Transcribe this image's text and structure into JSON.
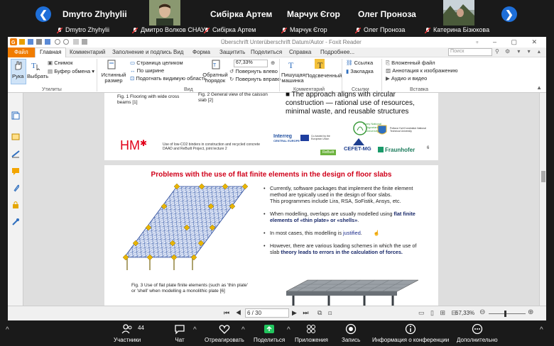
{
  "participants_top": [
    {
      "name": "Dmytro Zhyhylii",
      "label": "Dmytro Zhyhylii"
    },
    {
      "name": "",
      "label": "Дмитро Волков СНАУ"
    },
    {
      "name": "Сибірка Артем",
      "label": "Сибірка Артем"
    },
    {
      "name": "Марчук Єгор",
      "label": "Марчук Єгор"
    },
    {
      "name": "Олег Проноза",
      "label": "Олег Проноза"
    },
    {
      "name": "",
      "label": "Катерина Бізюкова"
    }
  ],
  "window": {
    "title": "Überschrift Unterüberschrift   Datum/Autor - Foxit Reader",
    "menu": [
      "Файл",
      "Главная",
      "Комментарий",
      "Заполнение и подпись",
      "Вид",
      "Форма",
      "Защитить",
      "Поделиться",
      "Справка",
      "Подробнее..."
    ],
    "search_placeholder": "Поиск"
  },
  "ribbon": {
    "hand": "Рука",
    "select": "Выбрать",
    "snapshot": "Снимок",
    "clipboard": "Буфер обмена",
    "group_tools": "Утилиты",
    "actual_size": "Истинный размер",
    "fit_page": "Страница целиком",
    "fit_width": "По ширине",
    "fit_visible": "Подогнать видимую область",
    "reflow": "Обратный порядок",
    "zoom": "67,33%",
    "rotate_left": "Повернуть влево",
    "rotate_right": "Повернуть вправо",
    "group_view": "Вид",
    "typewriter": "Пишущая машинка",
    "highlight": "Подсвеченный",
    "group_comment": "Комментарий",
    "link": "Ссылка",
    "bookmark": "Закладка",
    "group_links": "Ссылки",
    "attach_file": "Вложенный файл",
    "image_annot": "Аннотация к изображению",
    "audio_video": "Аудио и видео",
    "group_insert": "Вставка"
  },
  "page1": {
    "fig1": "Fig. 1 Flooring with wide cross beams [1]",
    "fig2": "Fig. 2 General view of the caisson slab [2]",
    "bullet": "The approach aligns with circular construction — rational use of resources, minimal waste, and reusable structures",
    "hm": "HM",
    "footer": "Use of low-CO2 binders in construction and recycled concrete DAAD and ReBuilt Project, joint lecture 2",
    "interreg": "Interreg",
    "interreg_sub": "CENTRAL EUROPE",
    "eu": "Co-funded by the European Union",
    "sumy": "Sumy National Agrarian University",
    "cefet": "CEFET-MG",
    "fraunhofer": "Fraunhofer",
    "poltava": "Poltava Yurii Kondratiuk National Technical University",
    "rebuilt": "ReBuilt",
    "page_no": "6"
  },
  "page2": {
    "title": "Problems with the use of flat finite elements in the design of floor slabs",
    "b1": "Currently, software packages that implement the finite element method are typically used in the design of floor slabs.",
    "b1b": "This programmes include Lira, RSA, SoFistik, Ansys, etc.",
    "b2a": "When modelling, overlaps are usually modelled using ",
    "b2b": "flat finite elements of «thin plate» or «shells»",
    "b2c": ".",
    "b3a": "In most cases, this modelling is ",
    "b3b": "justified",
    "b3c": ".",
    "b4a": "However, there are various loading schemes in which the use of slab ",
    "b4b": "theory leads to errors in the calculation of forces.",
    "fig3": "Fig. 3 Use of flat plate finite elements (such as 'thin plate' or 'shell' when modelling a monolithic plate [6]"
  },
  "status": {
    "page": "6 / 30",
    "zoom": "67,33%"
  },
  "bottom": {
    "participants_count": "44",
    "participants": "Участники",
    "chat": "Чат",
    "react": "Отреагировать",
    "share": "Поделиться",
    "apps": "Приложения",
    "record": "Запись",
    "info": "Информация о конференции",
    "more": "Дополнительно"
  },
  "colors": {
    "accent": "#1e6fd9",
    "foxit_orange": "#f07c00",
    "title_red": "#d0001a",
    "share_green": "#22c55e"
  }
}
